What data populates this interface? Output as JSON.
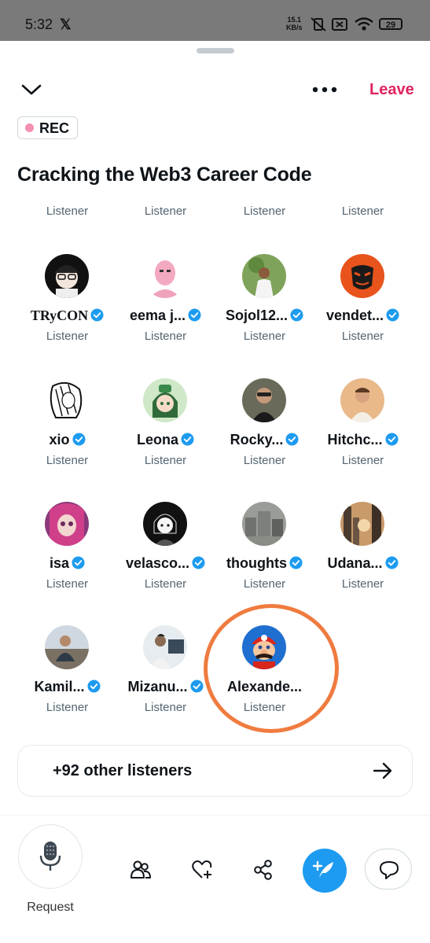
{
  "status_bar": {
    "time": "5:32",
    "app_icon": "x-logo",
    "net_speed_value": "15.1",
    "net_speed_unit": "KB/s",
    "battery": "29"
  },
  "header": {
    "leave_label": "Leave",
    "rec_label": "REC",
    "title": "Cracking the Web3 Career Code"
  },
  "top_row_roles": [
    "Listener",
    "Listener",
    "Listener",
    "Listener"
  ],
  "participants": [
    {
      "name": "TRyCON",
      "role": "Listener",
      "verified": true
    },
    {
      "name": "eema j...",
      "role": "Listener",
      "verified": true
    },
    {
      "name": "Sojol12...",
      "role": "Listener",
      "verified": true
    },
    {
      "name": "vendet...",
      "role": "Listener",
      "verified": true
    },
    {
      "name": "xio",
      "role": "Listener",
      "verified": true
    },
    {
      "name": "Leona",
      "role": "Listener",
      "verified": true
    },
    {
      "name": "Rocky...",
      "role": "Listener",
      "verified": true
    },
    {
      "name": "Hitchc...",
      "role": "Listener",
      "verified": true
    },
    {
      "name": "isa",
      "role": "Listener",
      "verified": true
    },
    {
      "name": "velasco...",
      "role": "Listener",
      "verified": true
    },
    {
      "name": "thoughts",
      "role": "Listener",
      "verified": true
    },
    {
      "name": "Udana...",
      "role": "Listener",
      "verified": true
    },
    {
      "name": "Kamil...",
      "role": "Listener",
      "verified": true
    },
    {
      "name": "Mizanu...",
      "role": "Listener",
      "verified": true
    },
    {
      "name": "Alexande...",
      "role": "Listener",
      "verified": false
    }
  ],
  "others": {
    "label": "+92 other listeners"
  },
  "toolbar": {
    "request_label": "Request"
  },
  "colors": {
    "accent": "#1d9bf0",
    "leave": "#e0245e",
    "highlight": "#f07b3f"
  }
}
